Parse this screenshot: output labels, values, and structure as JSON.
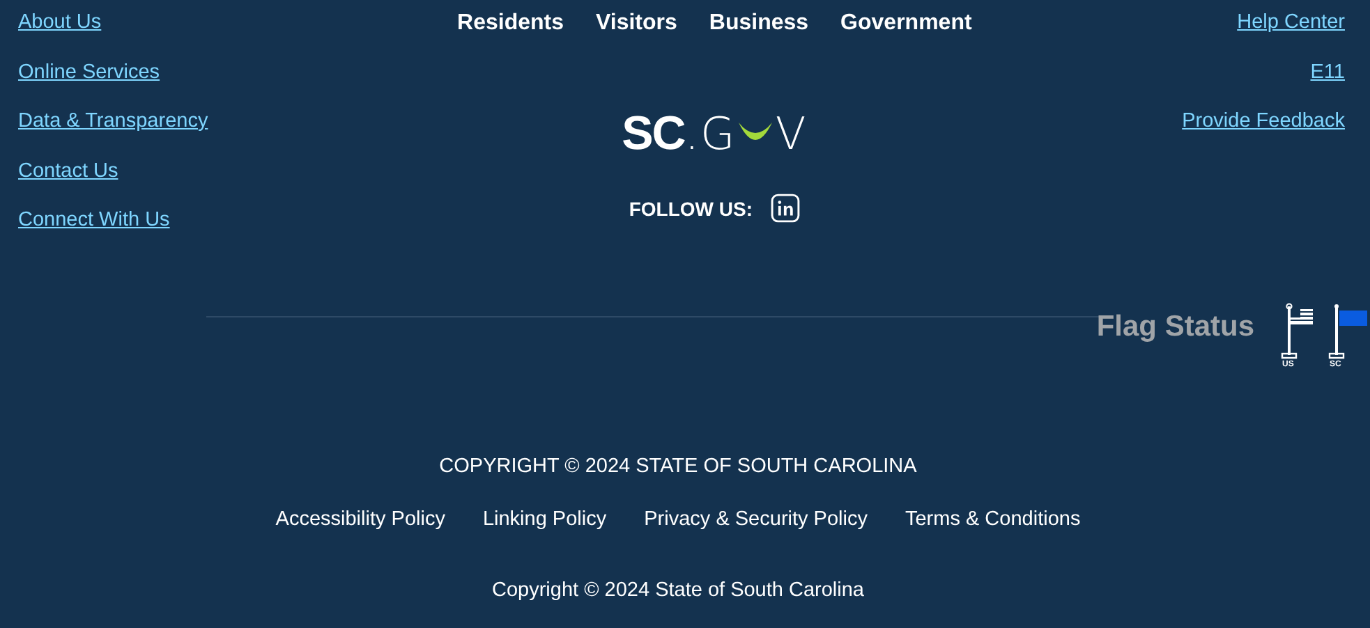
{
  "left_links": [
    "About Us",
    "Online Services",
    "Data & Transparency",
    "Contact Us",
    "Connect With Us"
  ],
  "nav": [
    "Residents",
    "Visitors",
    "Business",
    "Government"
  ],
  "right_links": [
    "Help Center",
    "E11",
    "Provide Feedback"
  ],
  "logo": {
    "bold": "SC",
    "light_before": ".G",
    "light_after": "V"
  },
  "follow": {
    "label": "FOLLOW US:"
  },
  "flag_status": {
    "label": "Flag Status",
    "flags": [
      {
        "label": "US",
        "kind": "us"
      },
      {
        "label": "SC",
        "kind": "sc",
        "color": "#0a5ce0"
      }
    ]
  },
  "copyright_upper": "COPYRIGHT © 2024 STATE OF SOUTH CAROLINA",
  "policies": [
    "Accessibility Policy",
    "Linking Policy",
    "Privacy & Security Policy",
    "Terms & Conditions"
  ],
  "copyright": "Copyright © 2024 State of South Carolina"
}
